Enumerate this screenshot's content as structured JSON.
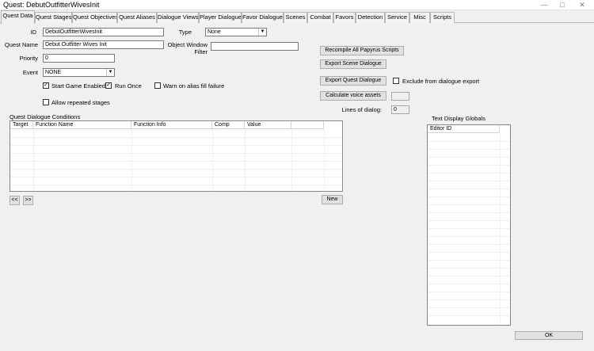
{
  "window": {
    "title": "Quest: DebutOutfitterWivesInit"
  },
  "tabs": [
    {
      "label": "Quest Data",
      "active": true
    },
    {
      "label": "Quest Stages"
    },
    {
      "label": "Quest Objectives"
    },
    {
      "label": "Quest Aliases"
    },
    {
      "label": "Dialogue Views"
    },
    {
      "label": "Player Dialogue"
    },
    {
      "label": "Favor Dialogue"
    },
    {
      "label": "Scenes"
    },
    {
      "label": "Combat"
    },
    {
      "label": "Favors"
    },
    {
      "label": "Detection"
    },
    {
      "label": "Service"
    },
    {
      "label": "Misc"
    },
    {
      "label": "Scripts"
    }
  ],
  "form": {
    "id_label": "ID",
    "id_value": "DebutOutfitterWivesInit",
    "quest_name_label": "Quest Name",
    "quest_name_value": "Debut Outfitter Wives Init",
    "priority_label": "Priority",
    "priority_value": "0",
    "event_label": "Event",
    "event_value": "NONE",
    "type_label": "Type",
    "type_value": "None",
    "object_window_filter_label_1": "Object Window",
    "object_window_filter_label_2": "Filter",
    "object_window_filter_value": ""
  },
  "checkboxes": {
    "start_game_enabled": {
      "label": "Start Game Enabled",
      "checked": true,
      "mark": "✓"
    },
    "run_once": {
      "label": "Run Once",
      "checked": true,
      "mark": "✓"
    },
    "warn_alias": {
      "label": "Warn on alias fill failure",
      "checked": false
    },
    "allow_repeated": {
      "label": "Allow repeated stages",
      "checked": false
    },
    "exclude_export": {
      "label": "Exclude from dialogue export",
      "checked": false
    }
  },
  "buttons": {
    "recompile": "Recompile All Papyrus Scripts",
    "export_scene": "Export Scene Dialogue",
    "export_quest": "Export Quest Dialogue",
    "calculate_voice": "Calculate voice assets",
    "new": "New",
    "prev": "<<",
    "next": ">>",
    "ok": "OK"
  },
  "lines_of_dialog": {
    "label": "Lines of dialog:",
    "value": "0"
  },
  "conditions": {
    "title": "Quest Dialogue Conditions",
    "columns": [
      "Target",
      "Function Name",
      "Function Info",
      "Comp",
      "Value"
    ]
  },
  "globals": {
    "title": "Text Display Globals",
    "columns": [
      "Editor ID"
    ]
  }
}
